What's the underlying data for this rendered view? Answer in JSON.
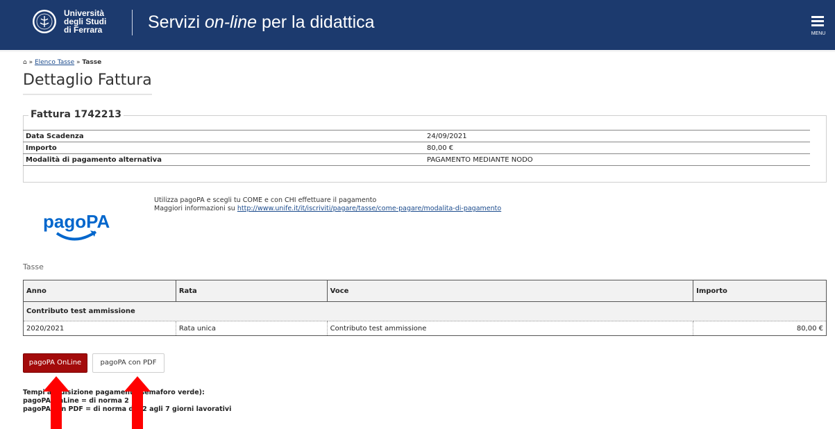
{
  "header": {
    "university_line1": "Università",
    "university_line2": "degli Studi",
    "university_line3": "di Ferrara",
    "title_prefix": "Servizi ",
    "title_italic": "on-line",
    "title_suffix": " per la didattica",
    "menu_label": "MENU",
    "bg_color": "#1c3a6e"
  },
  "breadcrumb": {
    "sep1": " » ",
    "link": "Elenco Tasse",
    "sep2": " » ",
    "current": "Tasse"
  },
  "page_title": "Dettaglio Fattura",
  "invoice": {
    "legend": "Fattura 1742213",
    "rows": [
      {
        "label": "Data Scadenza",
        "value": "24/09/2021"
      },
      {
        "label": "Importo",
        "value": "80,00 €"
      },
      {
        "label": "Modalità di pagamento alternativa",
        "value": "PAGAMENTO MEDIANTE NODO"
      }
    ]
  },
  "pagopa": {
    "logo_text": "pagoPA",
    "info_line1": "Utilizza pagoPA e scegli tu COME e con CHI effettuare il pagamento",
    "info_line2_prefix": "Maggiori informazioni su ",
    "info_link": "http://www.unife.it/it/iscriviti/pagare/tasse/come-pagare/modalita-di-pagamento"
  },
  "tasse": {
    "section_title": "Tasse",
    "columns": [
      "Anno",
      "Rata",
      "Voce",
      "Importo"
    ],
    "group": "Contributo test ammissione",
    "rows": [
      {
        "anno": "2020/2021",
        "rata": "Rata unica",
        "voce": "Contributo test ammissione",
        "importo": "80,00 €"
      }
    ]
  },
  "buttons": {
    "online": "pagoPA OnLine",
    "pdf": "pagoPA con PDF",
    "online_color": "#a30b0b"
  },
  "notes": {
    "line1": "Tempi acquisizione pagamenti (semaforo verde):",
    "line2": "pagoPA OnLine = di norma 2",
    "line3": "pagoPA con PDF = di norma dai 2 agli 7 giorni lavorativi"
  },
  "annotation_color": "#ff0000"
}
